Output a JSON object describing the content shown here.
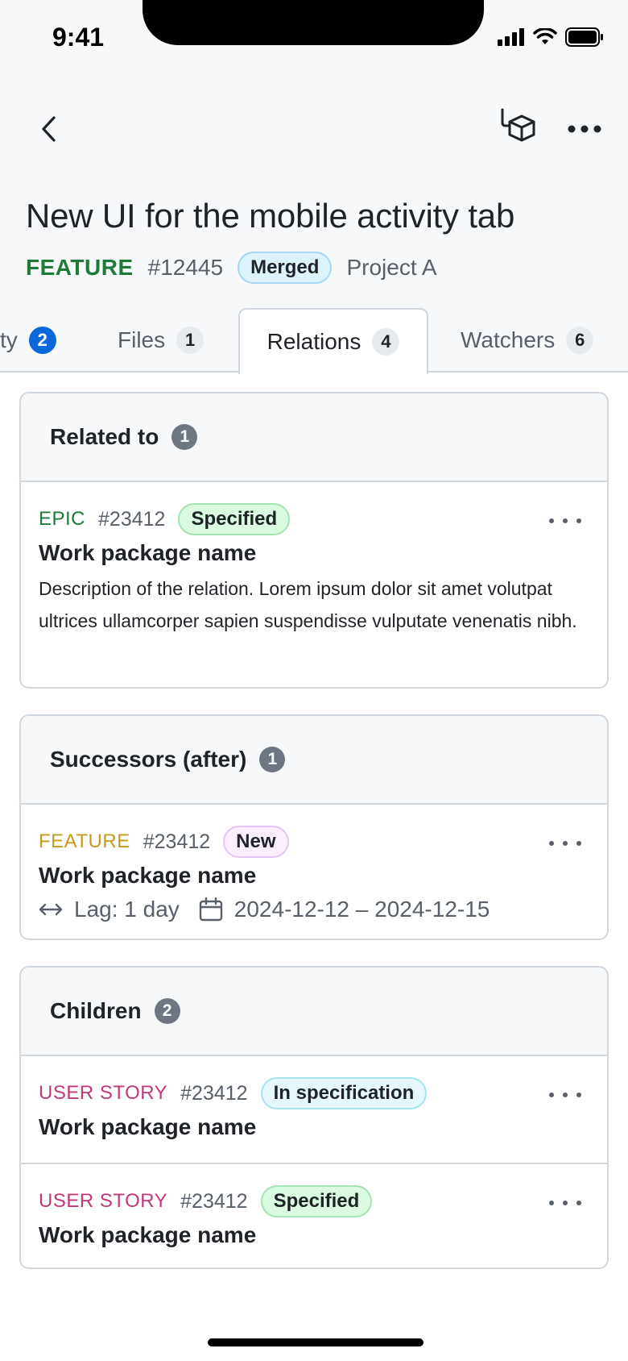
{
  "status_bar": {
    "time": "9:41"
  },
  "title": "New UI for the mobile activity tab",
  "meta": {
    "type": "FEATURE",
    "id": "#12445",
    "badge": "Merged",
    "project": "Project A"
  },
  "tabs": [
    {
      "label": "ty",
      "count": "2"
    },
    {
      "label": "Files",
      "count": "1"
    },
    {
      "label": "Relations",
      "count": "4"
    },
    {
      "label": "Watchers",
      "count": "6"
    }
  ],
  "sections": [
    {
      "title": "Related to",
      "count": "1",
      "items": [
        {
          "type": "EPIC",
          "id": "#23412",
          "status": "Specified",
          "name": "Work package name",
          "description": "Description of the relation. Lorem ipsum dolor sit amet volutpat ultrices ullamcorper sapien suspendisse vulputate venenatis nibh."
        }
      ]
    },
    {
      "title": "Successors (after)",
      "count": "1",
      "items": [
        {
          "type": "FEATURE",
          "id": "#23412",
          "status": "New",
          "name": "Work package name",
          "lag": "Lag: 1 day",
          "dates": "2024-12-12 – 2024-12-15"
        }
      ]
    },
    {
      "title": "Children",
      "count": "2",
      "items": [
        {
          "type": "USER STORY",
          "id": "#23412",
          "status": "In specification",
          "name": "Work package name"
        },
        {
          "type": "USER STORY",
          "id": "#23412",
          "status": "Specified",
          "name": "Work package name"
        }
      ]
    }
  ],
  "colors": {
    "active_tab_count": "#0969da",
    "epic": "#1f7a3a",
    "feature": "#c69a1a",
    "user_story": "#c0397a"
  }
}
